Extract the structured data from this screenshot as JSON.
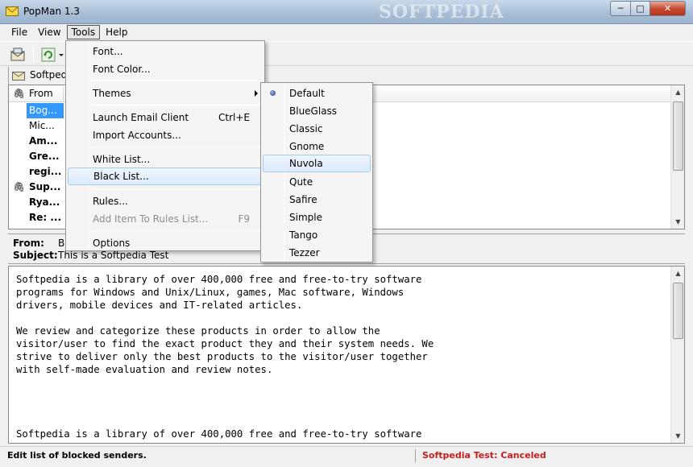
{
  "window": {
    "title": "PopMan 1.3",
    "watermark": "SOFTPEDIA",
    "minimize_glyph": "─",
    "maximize_glyph": "□",
    "close_glyph": "✕"
  },
  "menubar": {
    "items": [
      "File",
      "View",
      "Tools",
      "Help"
    ],
    "open_item": "Tools"
  },
  "toolbar": {
    "icons": [
      "mail-check-icon",
      "refresh-icon",
      "dropdown-arrow-icon"
    ]
  },
  "account": {
    "tab_label": "Softpedia"
  },
  "message_list": {
    "columns": {
      "attachment_glyph": "🖇",
      "from": "From"
    },
    "rows": [
      {
        "from": "Bog...",
        "attachment": false,
        "bold": false,
        "selected": true
      },
      {
        "from": "Mic...",
        "attachment": false,
        "bold": false,
        "selected": false
      },
      {
        "from": "Am...",
        "attachment": false,
        "bold": true,
        "selected": false
      },
      {
        "from": "Gre...",
        "attachment": false,
        "bold": true,
        "selected": false
      },
      {
        "from": "regi...",
        "attachment": false,
        "bold": true,
        "selected": false
      },
      {
        "from": "Sup...",
        "attachment": true,
        "bold": true,
        "selected": false
      },
      {
        "from": "Rya...",
        "attachment": false,
        "bold": true,
        "selected": false
      },
      {
        "from": "Re: ...",
        "attachment": false,
        "bold": true,
        "selected": false
      }
    ]
  },
  "header_pane": {
    "from_label": "From:",
    "from_value": "B",
    "subject_label": "Subject:",
    "subject_value": "This is a Softpedia Test"
  },
  "body": {
    "text": "Softpedia is a library of over 400,000 free and free-to-try software\nprograms for Windows and Unix/Linux, games, Mac software, Windows\ndrivers, mobile devices and IT-related articles.\n\nWe review and categorize these products in order to allow the\nvisitor/user to find the exact product they and their system needs. We\nstrive to deliver only the best products to the visitor/user together\nwith self-made evaluation and review notes.\n\n\n\n\nSoftpedia is a library of over 400,000 free and free-to-try software"
  },
  "status": {
    "left": "Edit list of blocked senders.",
    "right": "Softpedia Test:  Canceled",
    "right_color": "#c81c1c"
  },
  "tools_menu": {
    "items": [
      {
        "label": "Font...",
        "shortcut": "",
        "disabled": false,
        "submenu": false
      },
      {
        "label": "Font Color...",
        "shortcut": "",
        "disabled": false,
        "submenu": false
      },
      {
        "label": "Themes",
        "shortcut": "",
        "disabled": false,
        "submenu": true
      },
      {
        "label": "Launch Email Client",
        "shortcut": "Ctrl+E",
        "disabled": false,
        "submenu": false
      },
      {
        "label": "Import Accounts...",
        "shortcut": "",
        "disabled": false,
        "submenu": false
      },
      {
        "label": "White List...",
        "shortcut": "",
        "disabled": false,
        "submenu": false
      },
      {
        "label": "Black List...",
        "shortcut": "",
        "disabled": false,
        "submenu": false,
        "hover": true
      },
      {
        "label": "Rules...",
        "shortcut": "",
        "disabled": false,
        "submenu": false
      },
      {
        "label": "Add Item To Rules List...",
        "shortcut": "F9",
        "disabled": true,
        "submenu": false
      },
      {
        "label": "Options",
        "shortcut": "",
        "disabled": false,
        "submenu": false
      }
    ]
  },
  "themes_menu": {
    "selected": "Default",
    "hover": "Nuvola",
    "items": [
      "Default",
      "BlueGlass",
      "Classic",
      "Gnome",
      "Nuvola",
      "Qute",
      "Safire",
      "Simple",
      "Tango",
      "Tezzer"
    ]
  },
  "colors": {
    "selection": "#3399ff",
    "menu_hover_border": "#a8c8ec",
    "titlebar": "#a9bfd6"
  }
}
